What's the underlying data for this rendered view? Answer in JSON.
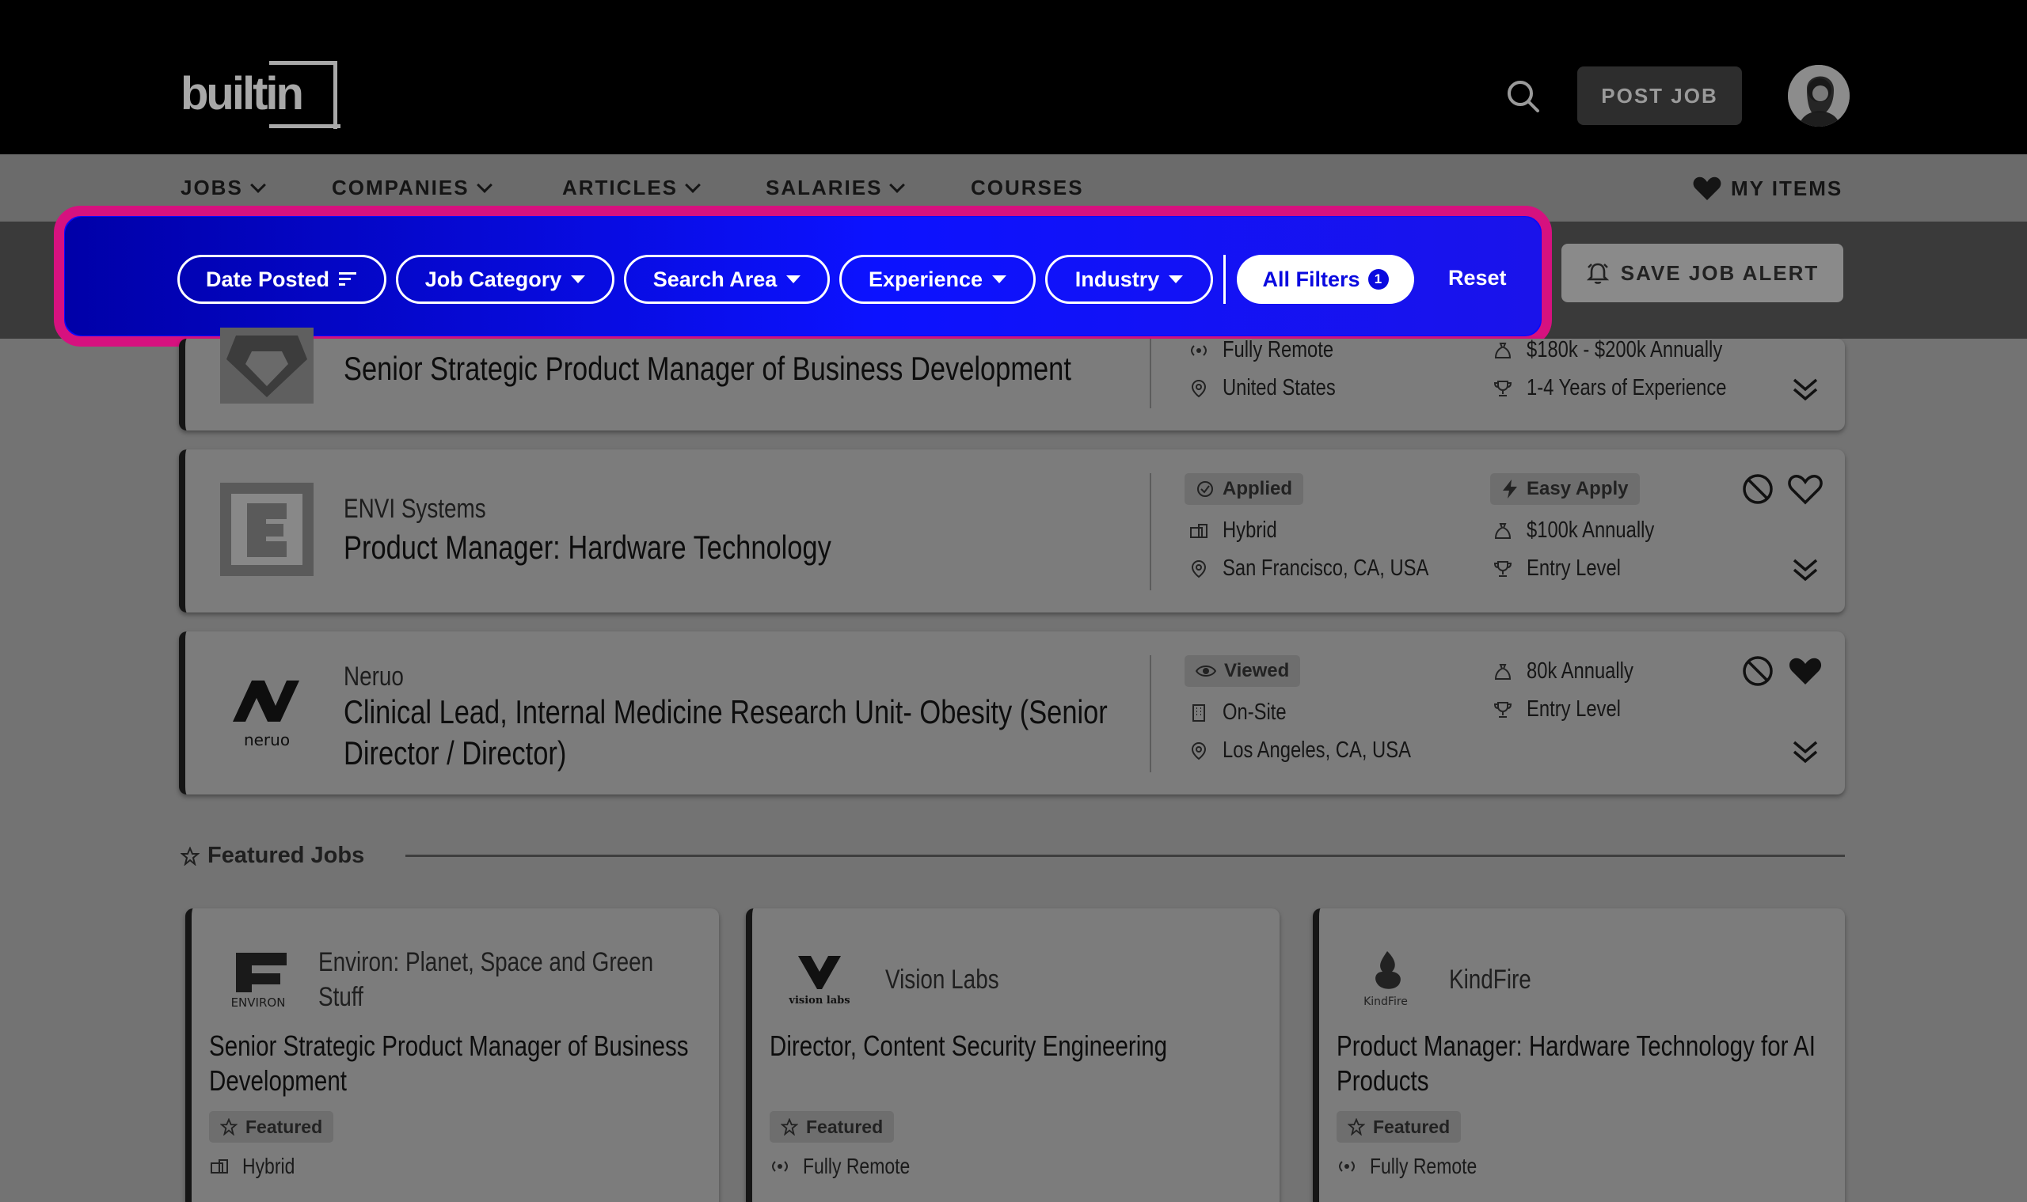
{
  "header": {
    "logo_text": "builtin",
    "post_job_label": "POST JOB"
  },
  "nav": {
    "items": [
      {
        "label": "JOBS"
      },
      {
        "label": "COMPANIES"
      },
      {
        "label": "ARTICLES"
      },
      {
        "label": "SALARIES"
      },
      {
        "label": "COURSES"
      }
    ],
    "my_items_label": "MY ITEMS"
  },
  "filters": {
    "pills": [
      {
        "label": "Date Posted"
      },
      {
        "label": "Job Category"
      },
      {
        "label": "Search Area"
      },
      {
        "label": "Experience"
      },
      {
        "label": "Industry"
      }
    ],
    "all_filters_label": "All Filters",
    "all_filters_count": "1",
    "reset_label": "Reset",
    "save_alert_label": "SAVE JOB ALERT",
    "highlight_color": "#d6117f",
    "bar_color": "#0c12ff"
  },
  "jobs": [
    {
      "logo_text": "GEM",
      "title": "Senior Strategic Product Manager of Business Development",
      "work_type": "Fully Remote",
      "location": "United States",
      "salary": "$180k - $200k Annually",
      "experience": "1-4 Years of Experience"
    },
    {
      "logo_text": "E",
      "company": "ENVI Systems",
      "title": "Product Manager: Hardware Technology",
      "status": "Applied",
      "easy_apply": "Easy Apply",
      "work_type": "Hybrid",
      "location": "San Francisco, CA, USA",
      "salary": "$100k Annually",
      "experience": "Entry Level"
    },
    {
      "logo_text": "neruo",
      "company": "Neruo",
      "title_line1": "Clinical Lead, Internal Medicine Research Unit- Obesity (Senior",
      "title_line2": "Director / Director)",
      "status": "Viewed",
      "work_type": "On-Site",
      "location": "Los Angeles, CA, USA",
      "salary": "80k Annually",
      "experience": "Entry Level"
    }
  ],
  "featured": {
    "section_label": "Featured Jobs",
    "cards": [
      {
        "company_line1": "Environ: Planet, Space and Green",
        "company_line2": "Stuff",
        "logo_text": "ENVIRON",
        "title_line1": "Senior Strategic Product Manager of Business",
        "title_line2": "Development",
        "badge": "Featured",
        "work_type": "Hybrid"
      },
      {
        "company_line1": "Vision Labs",
        "logo_text": "vision labs",
        "title_line1": "Director, Content Security Engineering",
        "title_line2": "",
        "badge": "Featured",
        "work_type": "Fully Remote"
      },
      {
        "company_line1": "KindFire",
        "logo_text": "KindFire",
        "title_line1": "Product Manager: Hardware Technology for AI",
        "title_line2": "Products",
        "badge": "Featured",
        "work_type": "Fully Remote"
      }
    ]
  }
}
